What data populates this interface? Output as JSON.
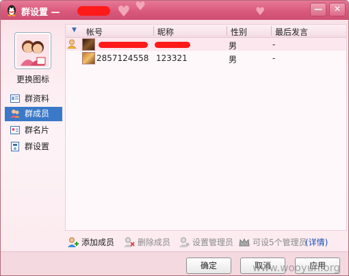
{
  "titlebar": {
    "title": "群设置 — ",
    "minimize_glyph": "—",
    "close_glyph": "✕"
  },
  "sidebar": {
    "change_icon_label": "更换图标",
    "items": [
      {
        "label": "群资料",
        "icon": "profile-card-icon"
      },
      {
        "label": "群成员",
        "icon": "members-icon"
      },
      {
        "label": "群名片",
        "icon": "name-card-icon"
      },
      {
        "label": "群设置",
        "icon": "settings-icon"
      }
    ]
  },
  "table": {
    "headers": [
      "帐号",
      "昵称",
      "性别",
      "最后发言"
    ],
    "rows": [
      {
        "account": "",
        "nickname": "",
        "gender": "男",
        "last_speak": "-"
      },
      {
        "account": "2857124558",
        "nickname": "123321",
        "gender": "男",
        "last_speak": "-"
      }
    ]
  },
  "toolbar": {
    "add_member": "添加成员",
    "delete_member": "删除成员",
    "set_admin": "设置管理员",
    "admin_limit": "可设5个管理员",
    "details": "(详情)"
  },
  "footer": {
    "ok": "确定",
    "cancel": "取消",
    "apply": "应用"
  },
  "watermark": "www.wooyun.org",
  "colors": {
    "title_bar": "#d9597c",
    "selected_nav": "#3a78c8",
    "redaction": "#ff1a1a",
    "link": "#1b4fb8"
  }
}
